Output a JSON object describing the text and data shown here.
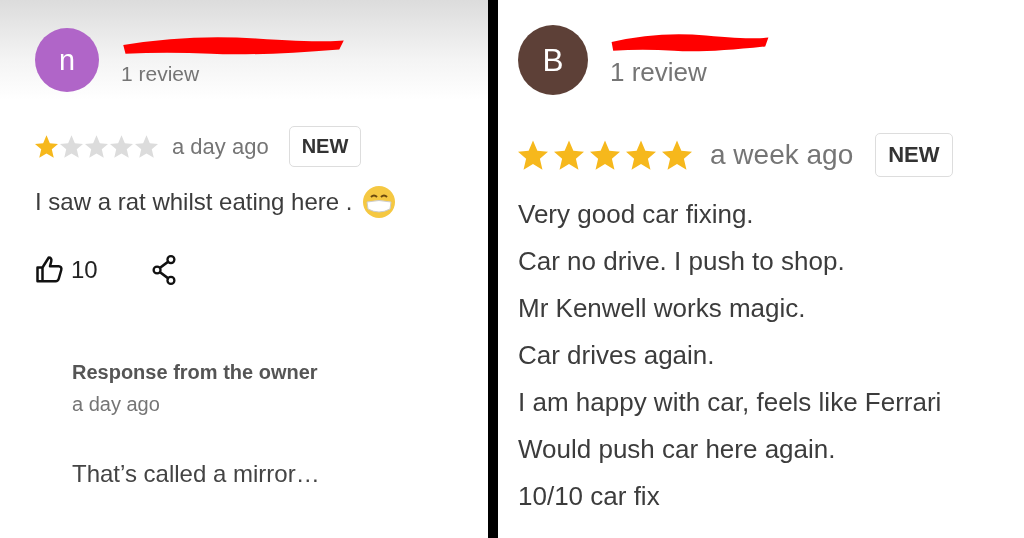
{
  "reviews": [
    {
      "kind": "compact",
      "avatar_letter": "n",
      "color": "#b065c8",
      "name_redacted": true,
      "review_count": "1 review",
      "stars": 1,
      "time": "a day ago",
      "badge": "NEW",
      "text_lines": [
        "I saw a rat whilst eating here ."
      ],
      "has_emoji": true,
      "likes": "10",
      "owner_response": {
        "title": "Response from the owner",
        "time": "a day ago",
        "text": "That’s called a mirror…"
      }
    },
    {
      "kind": "zoomed",
      "avatar_letter": "B",
      "color": "#5d4037",
      "name_redacted": true,
      "review_count": "1 review",
      "stars": 5,
      "time": "a week ago",
      "badge": "NEW",
      "text_lines": [
        "Very good car fixing.",
        "Car no drive. I push to shop.",
        "Mr Kenwell works magic.",
        "Car drives again.",
        "I am happy with car, feels like Ferrari",
        "Would push car here again.",
        "10/10 car fix"
      ],
      "has_emoji": false
    }
  ]
}
